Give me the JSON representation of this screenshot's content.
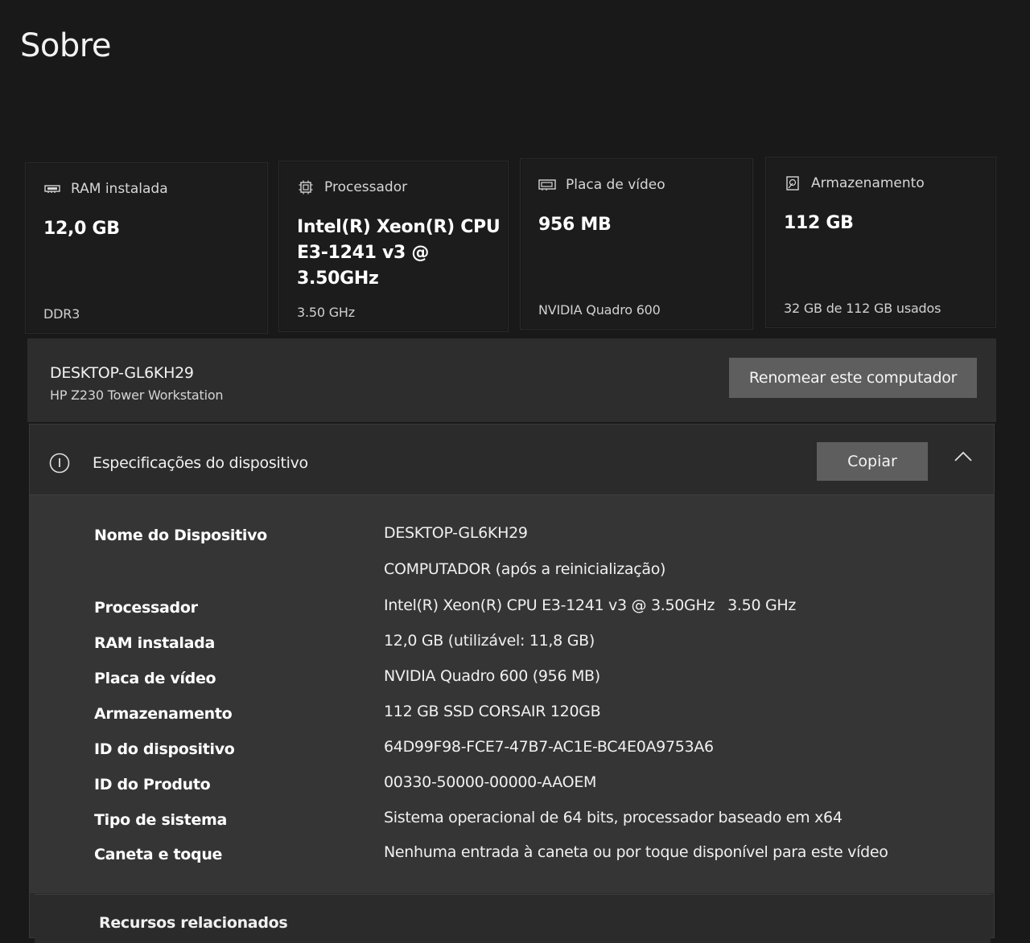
{
  "page": {
    "title": "Sobre"
  },
  "cards": {
    "ram": {
      "label": "RAM instalada",
      "icon": "ram-icon",
      "value": "12,0 GB",
      "sub": "DDR3"
    },
    "cpu": {
      "label": "Processador",
      "icon": "processor-icon",
      "value_line1": "Intel(R) Xeon(R) CPU",
      "value_line2": "E3-1241 v3 @ 3.50GHz",
      "sub": "3.50 GHz"
    },
    "gpu": {
      "label": "Placa de vídeo",
      "icon": "graphics-card-icon",
      "value": "956 MB",
      "sub": "NVIDIA Quadro 600"
    },
    "storage": {
      "label": "Armazenamento",
      "icon": "storage-icon",
      "value": "112 GB",
      "sub": "32 GB de 112 GB usados"
    }
  },
  "device": {
    "name": "DESKTOP-GL6KH29",
    "model": "HP Z230 Tower Workstation",
    "rename_label": "Renomear este computador"
  },
  "specs": {
    "title": "Especificações do dispositivo",
    "copy_label": "Copiar",
    "rows": [
      {
        "label": "Nome do Dispositivo",
        "value": "DESKTOP-GL6KH29"
      },
      {
        "label": "",
        "value": "COMPUTADOR (após a reinicialização)"
      },
      {
        "label": "Processador",
        "value": "Intel(R) Xeon(R) CPU E3-1241 v3 @ 3.50GHz",
        "value2": "3.50 GHz"
      },
      {
        "label": "RAM instalada",
        "value": "12,0 GB (utilizável: 11,8 GB)"
      },
      {
        "label": "Placa de vídeo",
        "value": "NVIDIA Quadro 600 (956 MB)"
      },
      {
        "label": "Armazenamento",
        "value": "112 GB SSD CORSAIR 120GB"
      },
      {
        "label": "ID do dispositivo",
        "value": "64D99F98-FCE7-47B7-AC1E-BC4E0A9753A6"
      },
      {
        "label": "ID do Produto",
        "value": "00330-50000-00000-AAOEM"
      },
      {
        "label": "Tipo de sistema",
        "value": "Sistema operacional de 64 bits, processador baseado em x64"
      },
      {
        "label": "Caneta e toque",
        "value": "Nenhuma entrada à caneta ou por toque disponível para este vídeo"
      }
    ],
    "next_section_title": "Recursos relacionados"
  }
}
